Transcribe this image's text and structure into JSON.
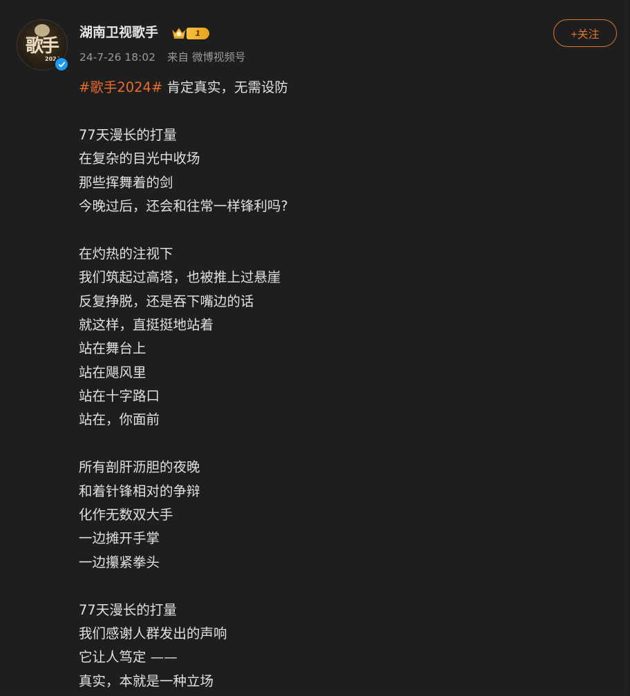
{
  "author": {
    "name": "湖南卫视歌手",
    "level_badge": "1",
    "avatar_text": "歌手",
    "avatar_year": "2024"
  },
  "meta": {
    "time": "24-7-26 18:02",
    "source": "来自 微博视频号"
  },
  "follow_button": {
    "label": "+关注"
  },
  "post": {
    "hashtag": "#歌手2024#",
    "headline": " 肯定真实，无需设防",
    "lines": [
      "",
      "77天漫长的打量",
      "在复杂的目光中收场",
      "那些挥舞着的剑",
      "今晚过后，还会和往常一样锋利吗?",
      "",
      "在灼热的注视下",
      "我们筑起过高塔，也被推上过悬崖",
      "反复挣脱，还是吞下嘴边的话",
      "就这样，直挺挺地站着",
      "站在舞台上",
      "站在飓风里",
      "站在十字路口",
      "站在，你面前",
      "",
      "所有剖肝沥胆的夜晚",
      "和着针锋相对的争辩",
      "化作无数双大手",
      "一边摊开手掌",
      "一边攥紧拳头",
      "",
      "77天漫长的打量",
      "我们感谢人群发出的声响",
      "它让人笃定 ——",
      "真实，本就是一种立场"
    ]
  },
  "colors": {
    "background": "#1e1e1e",
    "text": "#e0e0e0",
    "meta": "#9a9a9a",
    "accent": "#e0762b",
    "hashtag": "#e86b2a",
    "verified": "#1d9bf0"
  },
  "icons": [
    "verified-icon",
    "crown-icon",
    "level-badge-icon"
  ]
}
